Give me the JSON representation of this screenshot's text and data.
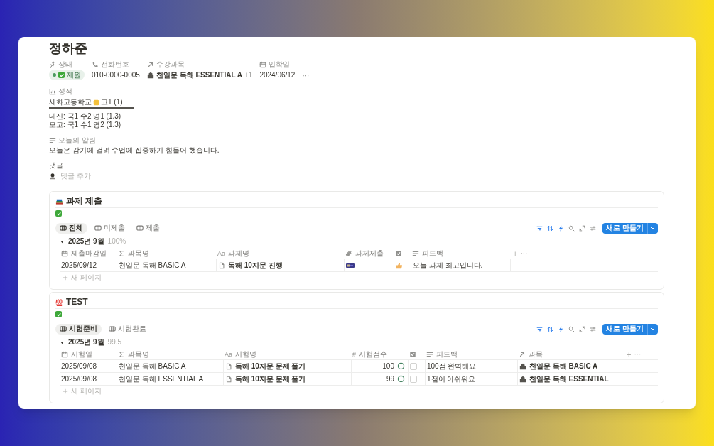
{
  "page": {
    "title": "정하준",
    "properties": [
      {
        "kind": "status",
        "label": "상태",
        "value": "재원",
        "color": "#4a9a5e",
        "checked": true
      },
      {
        "kind": "phone",
        "label": "전화번호",
        "value": "010-0000-0005"
      },
      {
        "kind": "relation",
        "label": "수강과목",
        "value": "천일문 독해 ESSENTIAL A",
        "more": "+1"
      },
      {
        "kind": "date",
        "label": "입학일",
        "value": "2024/06/12"
      }
    ],
    "more": "···",
    "grades": {
      "label": "성적",
      "tabs": [
        {
          "school": "세화고등학교",
          "grade": "고1 (1)",
          "selected": true
        }
      ],
      "lines": [
        "내신: 국1 수2 영1 (1.3)",
        "모고: 국1 수1 영2 (1.3)"
      ]
    },
    "notice": {
      "label": "오늘의 알림",
      "text": "오늘은 감기에 걸려 수업에 집중하기 힘들어 했습니다."
    },
    "comments": {
      "label": "댓글",
      "placeholder": "댓글 추가"
    }
  },
  "databases": [
    {
      "title": "과제 제출",
      "checked": true,
      "views": [
        {
          "label": "전체",
          "selected": true
        },
        {
          "label": "미제출",
          "selected": false
        },
        {
          "label": "제출",
          "selected": false
        }
      ],
      "new_button": "새로 만들기",
      "group": {
        "label": "2025년 9월",
        "summary": "100%",
        "expanded": true
      },
      "columns": [
        {
          "kind": "date",
          "label": "제출마감일"
        },
        {
          "kind": "formula",
          "label": "과목명"
        },
        {
          "kind": "title",
          "prefix": "Aa",
          "label": "과제명"
        },
        {
          "kind": "file",
          "label": "과제제출"
        },
        {
          "kind": "checkbox"
        },
        {
          "kind": "text",
          "label": "피드백"
        }
      ],
      "rows": [
        [
          {
            "kind": "text",
            "value": "2025/09/12"
          },
          {
            "kind": "text",
            "value": "천일문 독해 BASIC A"
          },
          {
            "kind": "page",
            "value": "독해 10지문 진행"
          },
          {
            "kind": "file"
          },
          {
            "kind": "thumb"
          },
          {
            "kind": "text",
            "value": "오늘 과제 최고입니다."
          }
        ]
      ],
      "add_column": "+",
      "column_more": "···",
      "new_row": "새 페이지"
    },
    {
      "title": "TEST",
      "checked": true,
      "views": [
        {
          "label": "시험준비",
          "selected": true
        },
        {
          "label": "시험완료",
          "selected": false
        }
      ],
      "new_button": "새로 만들기",
      "group": {
        "label": "2025년 9월",
        "summary": "99.5",
        "expanded": true
      },
      "columns": [
        {
          "kind": "date",
          "label": "시험일"
        },
        {
          "kind": "formula",
          "label": "과목명"
        },
        {
          "kind": "title",
          "prefix": "Aa",
          "label": "시험명"
        },
        {
          "kind": "number",
          "prefix": "#",
          "label": "시험점수"
        },
        {
          "kind": "checkbox"
        },
        {
          "kind": "text",
          "label": "피드백"
        },
        {
          "kind": "relation",
          "label": "과목"
        }
      ],
      "rows": [
        [
          {
            "kind": "text",
            "value": "2025/09/08"
          },
          {
            "kind": "text",
            "value": "천일문 독해 BASIC A"
          },
          {
            "kind": "page",
            "value": "독해 10지문 문제 풀기"
          },
          {
            "kind": "score",
            "value": "100"
          },
          {
            "kind": "checkbox",
            "checked": false
          },
          {
            "kind": "text",
            "value": "100점 완벽해요"
          },
          {
            "kind": "relation",
            "value": "천일문 독해 BASIC A"
          }
        ],
        [
          {
            "kind": "text",
            "value": "2025/09/08"
          },
          {
            "kind": "text",
            "value": "천일문 독해 ESSENTIAL A"
          },
          {
            "kind": "page",
            "value": "독해 10지문 문제 풀기"
          },
          {
            "kind": "score",
            "value": "99"
          },
          {
            "kind": "checkbox",
            "checked": false
          },
          {
            "kind": "text",
            "value": "1점이 아쉬워요"
          },
          {
            "kind": "relation",
            "value": "천일문 독해 ESSENTIAL"
          }
        ]
      ],
      "add_column": "+",
      "column_more": "···",
      "new_row": "새 페이지"
    }
  ]
}
